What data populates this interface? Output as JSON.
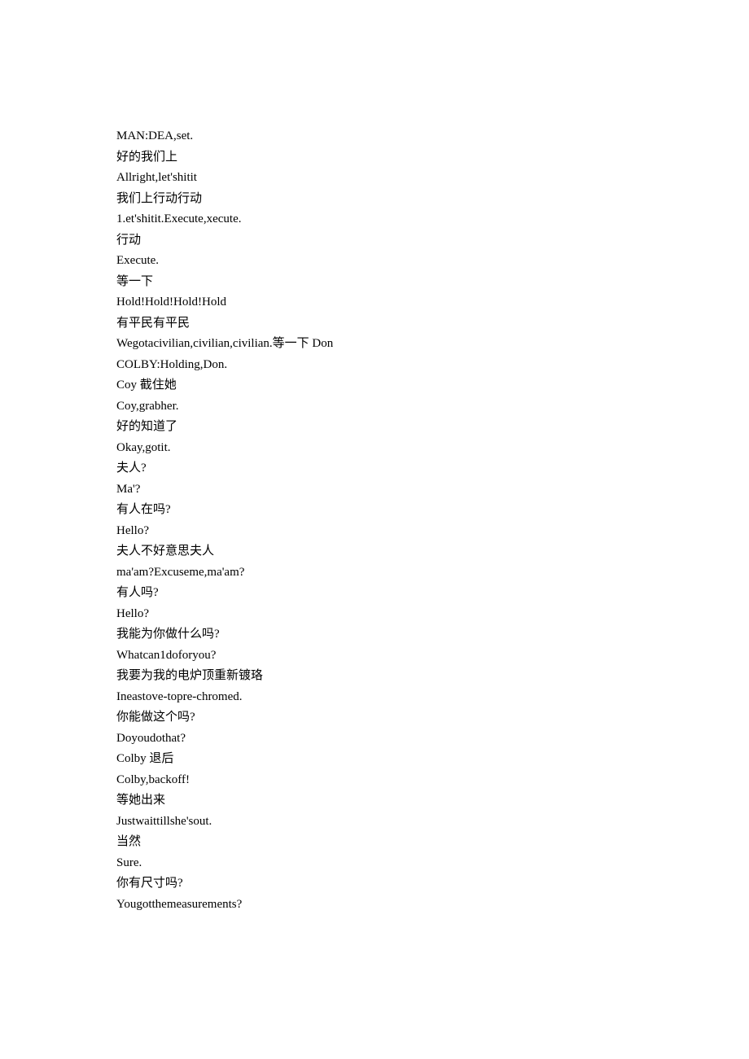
{
  "lines": [
    "MAN:DEA,set.",
    "好的我们上",
    "Allright,let'shitit",
    "我们上行动行动",
    "1.et'shitit.Execute,xecute.",
    "行动",
    "Execute.",
    "等一下",
    "Hold!Hold!Hold!Hold",
    "有平民有平民",
    "Wegotacivilian,civilian,civilian.等一下 Don",
    "COLBY:Holding,Don.",
    "Coy 截住她",
    "Coy,grabher.",
    "好的知道了",
    "Okay,gotit.",
    "夫人?",
    "Ma'?",
    "有人在吗?",
    "Hello?",
    "夫人不好意思夫人",
    "ma'am?Excuseme,ma'am?",
    "有人吗?",
    "Hello?",
    "我能为你做什么吗?",
    "Whatcan1doforyou?",
    "我要为我的电炉顶重新镀珞",
    "Ineastove-topre-chromed.",
    "你能做这个吗?",
    "Doyoudothat?",
    "Colby 退后",
    "Colby,backoff!",
    "等她出来",
    "Justwaittillshe'sout.",
    "当然",
    "Sure.",
    "你有尺寸吗?",
    "Yougotthemeasurements?"
  ]
}
